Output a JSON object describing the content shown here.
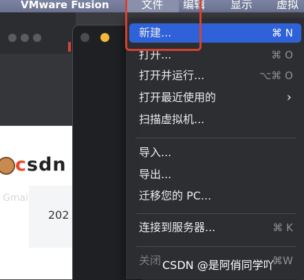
{
  "menubar": {
    "app_name": "VMware Fusion",
    "file": "文件",
    "edit": "编辑",
    "view": "显示",
    "vm": "虚拟"
  },
  "browser": {
    "bookmark_gmail": "Gmail",
    "site_logo_text": "CSDN",
    "year_text": "202"
  },
  "file_menu": {
    "items": [
      {
        "label": "新建...",
        "shortcut": "⌘ N",
        "state": "highlighted"
      },
      {
        "label": "打开...",
        "shortcut": "⌘ O",
        "state": "normal"
      },
      {
        "label": "打开并运行...",
        "shortcut": "⌥⌘ O",
        "state": "normal"
      },
      {
        "label": "打开最近使用的",
        "shortcut": "",
        "state": "submenu"
      },
      {
        "label": "扫描虚拟机...",
        "shortcut": "",
        "state": "normal"
      },
      {
        "label": "导入...",
        "shortcut": "",
        "state": "normal"
      },
      {
        "label": "导出...",
        "shortcut": "",
        "state": "normal"
      },
      {
        "label": "迁移您的 PC...",
        "shortcut": "",
        "state": "normal"
      },
      {
        "label": "连接到服务器...",
        "shortcut": "⌘ K",
        "state": "normal"
      },
      {
        "label": "关闭",
        "shortcut": "⌘W",
        "state": "disabled"
      }
    ]
  },
  "watermark": "CSDN @是阿俏同学吖",
  "colors": {
    "highlight": "#2f62d8",
    "annotation_frame": "#d9412e",
    "menubar": "#6b7290"
  }
}
